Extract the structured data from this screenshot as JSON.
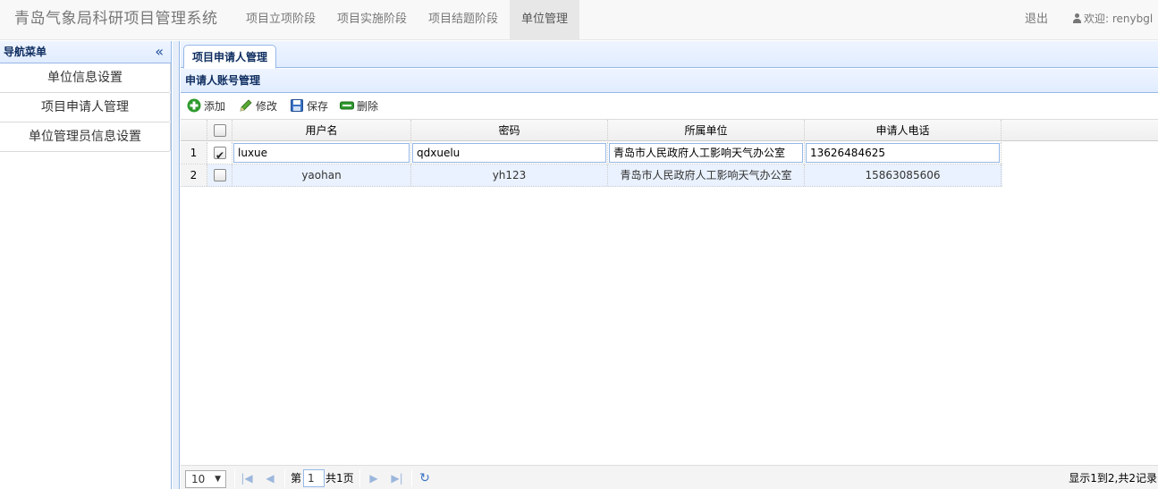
{
  "header": {
    "brand": "青岛气象局科研项目管理系统",
    "nav": [
      {
        "label": "项目立项阶段"
      },
      {
        "label": "项目实施阶段"
      },
      {
        "label": "项目结题阶段"
      },
      {
        "label": "单位管理"
      }
    ],
    "logout": "退出",
    "welcome": "欢迎: renybgl"
  },
  "sidebar": {
    "title": "导航菜单",
    "collapse_icon": "«",
    "items": [
      {
        "label": "单位信息设置"
      },
      {
        "label": "项目申请人管理"
      },
      {
        "label": "单位管理员信息设置"
      }
    ]
  },
  "tabs": [
    {
      "label": "项目申请人管理"
    }
  ],
  "grid": {
    "title": "申请人账号管理",
    "toolbar": {
      "add": "添加",
      "edit": "修改",
      "save": "保存",
      "delete": "删除"
    },
    "columns": [
      "用户名",
      "密码",
      "所属单位",
      "申请人电话"
    ],
    "rows": [
      {
        "num": "1",
        "checked": true,
        "username": "luxue",
        "password": "qdxuelu",
        "unit": "青岛市人民政府人工影响天气办公室",
        "phone": "13626484625"
      },
      {
        "num": "2",
        "checked": false,
        "username": "yaohan",
        "password": "yh123",
        "unit": "青岛市人民政府人工影响天气办公室",
        "phone": "15863085606"
      }
    ]
  },
  "pager": {
    "page_size": "10",
    "page_prefix": "第",
    "page_number": "1",
    "page_total": "共1页",
    "info": "显示1到2,共2记录"
  },
  "colors": {
    "accent_border": "#95b8e7",
    "header_bg": "#e0ecff",
    "title_text": "#0e2d5f",
    "alt_row": "#eaf2ff",
    "add_green": "#2e9a2e"
  }
}
